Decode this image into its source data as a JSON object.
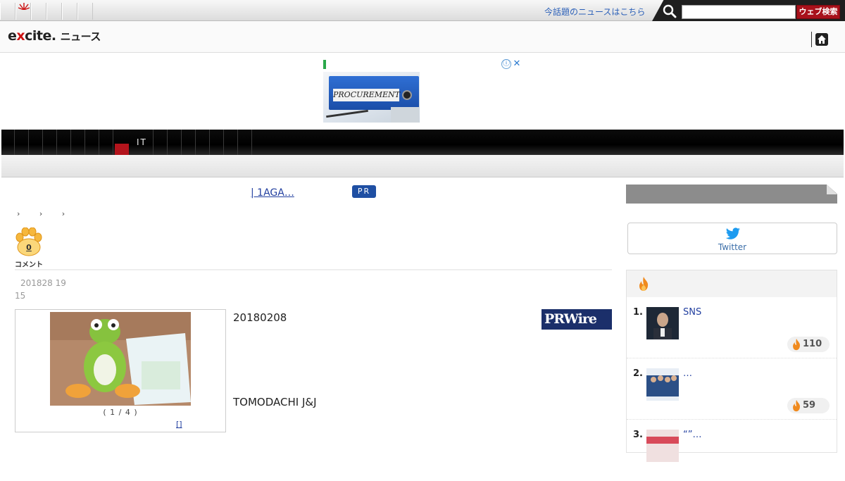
{
  "header": {
    "top_link": "今話題のニュースはこちら",
    "search_placeholder": "",
    "search_button": "ウェブ検索",
    "brand_left": "e",
    "brand_x": "x",
    "brand_right": "cite.",
    "brand_news": "ニュース"
  },
  "ad": {
    "binder_label": "PROCUREMENT",
    "info_icon": "ⓘ",
    "close_icon": "✕"
  },
  "nav": {
    "active_label": "IT"
  },
  "content": {
    "pr_link": "| 1AGA…",
    "pr_badge": "PR",
    "breadcrumb": "› › ›",
    "comment_count": "0",
    "comment_label": "コメント",
    "date_line1": "201828 19",
    "date_line2": "15",
    "photo_caption": "( 1 / 4 )",
    "photo_link": "[]",
    "article_line1": "20180208",
    "article_line2": "TOMODACHI J&J",
    "source_logo": "PRWire"
  },
  "sidebar": {
    "twitter_label": "Twitter",
    "ranking": [
      {
        "rank": "1.",
        "title": "SNS",
        "score": "110"
      },
      {
        "rank": "2.",
        "title": "…",
        "score": "59"
      },
      {
        "rank": "3.",
        "title": "“”…",
        "score": ""
      }
    ]
  },
  "colors": {
    "accent_red": "#a8111b",
    "link_blue": "#2340a0",
    "pr_badge_blue": "#1f4fa3",
    "flame_orange": "#f08a1e"
  },
  "icons": {
    "search": "search-icon",
    "home": "home-icon",
    "paw": "paw-icon",
    "twitter": "twitter-bird-icon",
    "flame": "flame-icon"
  }
}
